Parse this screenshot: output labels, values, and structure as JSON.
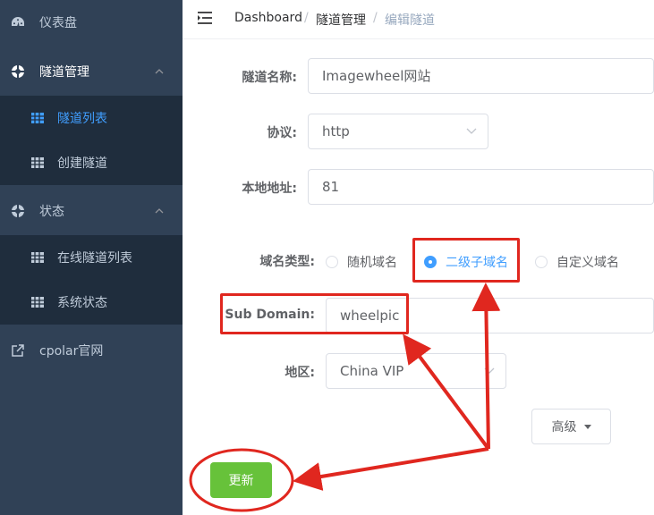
{
  "sidebar": {
    "items": [
      {
        "label": "仪表盘",
        "icon": "dashboard-icon"
      },
      {
        "label": "隧道管理",
        "icon": "tunnel-icon"
      },
      {
        "label": "隧道列表",
        "icon": "grid-icon"
      },
      {
        "label": "创建隧道",
        "icon": "grid-icon"
      },
      {
        "label": "状态",
        "icon": "status-icon"
      },
      {
        "label": "在线隧道列表",
        "icon": "grid-icon"
      },
      {
        "label": "系统状态",
        "icon": "grid-icon"
      },
      {
        "label": "cpolar官网",
        "icon": "external-link-icon"
      }
    ]
  },
  "breadcrumb": {
    "home": "Dashboard",
    "section": "隧道管理",
    "current": "编辑隧道",
    "separator": "/"
  },
  "form": {
    "tunnel_name_label": "隧道名称:",
    "tunnel_name_value": "Imagewheel网站",
    "protocol_label": "协议:",
    "protocol_value": "http",
    "local_addr_label": "本地地址:",
    "local_addr_value": "81",
    "domain_type_label": "域名类型:",
    "domain_types": [
      "随机域名",
      "二级子域名",
      "自定义域名"
    ],
    "domain_type_selected": "二级子域名",
    "subdomain_label": "Sub Domain:",
    "subdomain_value": "wheelpic",
    "region_label": "地区:",
    "region_value": "China VIP",
    "advanced_label": "高级",
    "update_label": "更新"
  },
  "colors": {
    "sidebar_bg": "#304156",
    "submenu_bg": "#1f2d3d",
    "active": "#409eff",
    "update_button": "#67c23a",
    "annotation": "#e0271f"
  }
}
